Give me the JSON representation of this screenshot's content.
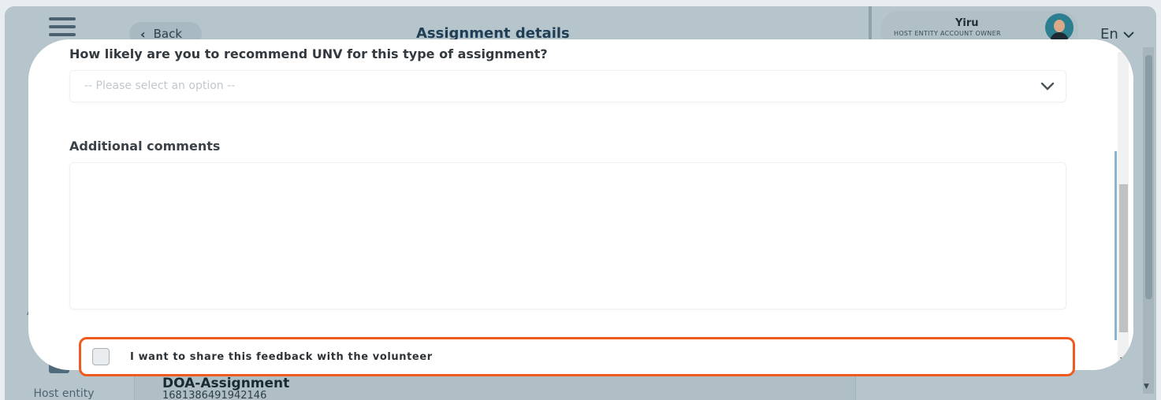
{
  "header": {
    "back_label": "Back",
    "title": "Assignment details",
    "user_name": "Yiru",
    "user_role": "HOST ENTITY ACCOUNT OWNER",
    "language": "En"
  },
  "sidebar": {
    "partial_label": "A",
    "host_entity_label": "Host entity account"
  },
  "background_card": {
    "title": "DOA-Assignment",
    "id": "1681386491942146"
  },
  "modal": {
    "recommend_question": "How likely are you to recommend UNV for this type of assignment?",
    "recommend_placeholder": "-- Please select an option --",
    "comments_label": "Additional comments",
    "comments_value": "",
    "share_checkbox_label": "I want to share this feedback with the volunteer",
    "share_checked": false
  },
  "colors": {
    "highlight": "#f05a1e",
    "title_text": "#1f3f56",
    "overlay_bg": "#b6c4cb"
  },
  "icons": {
    "menu": "hamburger-icon",
    "back": "chevron-left-icon",
    "select": "chevron-down-icon",
    "language": "chevron-down-icon"
  }
}
